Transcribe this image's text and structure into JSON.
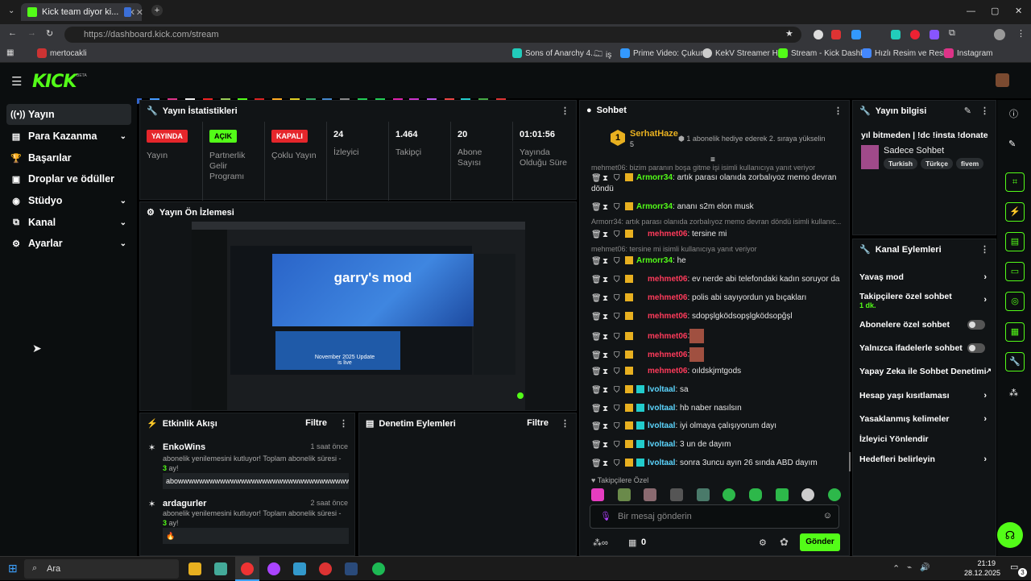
{
  "browser": {
    "tab_title": "Kick team diyor ki...",
    "url": "https://dashboard.kick.com/stream",
    "bookmarks": [
      "mertocakli",
      "Sons of Anarchy 4....",
      "iş",
      "Prime Video: Çukur...",
      "KekV Streamer Hub",
      "Stream - Kick Dashb...",
      "Hızlı Resim ve Resi...",
      "Instagram"
    ]
  },
  "logo": "KICK",
  "logo_beta": "BETA",
  "sidebar": [
    {
      "label": "Yayın",
      "icon": "broadcast-icon"
    },
    {
      "label": "Para Kazanma",
      "icon": "money-icon"
    },
    {
      "label": "Başarılar",
      "icon": "trophy-icon"
    },
    {
      "label": "Droplar ve ödüller",
      "icon": "gift-icon"
    },
    {
      "label": "Stüdyo",
      "icon": "studio-icon"
    },
    {
      "label": "Kanal",
      "icon": "channel-icon"
    },
    {
      "label": "Ayarlar",
      "icon": "settings-icon"
    }
  ],
  "stats": {
    "title": "Yayın İstatistikleri",
    "items": [
      {
        "badge": "YAYINDA",
        "badge_color": "#e5262b",
        "label": "Yayın"
      },
      {
        "badge": "AÇIK",
        "badge_color": "#53fc18",
        "label": "Partnerlik Gelir Programı"
      },
      {
        "badge": "KAPALI",
        "badge_color": "#e5262b",
        "label": "Çoklu Yayın"
      },
      {
        "num": "24",
        "label": "İzleyici"
      },
      {
        "num": "1.464",
        "label": "Takipçi"
      },
      {
        "num": "20",
        "label": "Abone Sayısı"
      },
      {
        "num": "01:01:56",
        "label": "Yayında Olduğu Süre"
      }
    ]
  },
  "preview": {
    "title": "Yayın Ön İzlemesi",
    "game": "garry's mod",
    "news": "November 2025 Update is live"
  },
  "activity": {
    "title": "Etkinlik Akışı",
    "filter": "Filtre",
    "items": [
      {
        "user": "EnkoWins",
        "time": "1 saat önce",
        "text_a": "abonelik yenilemesini kutluyor! Toplam abonelik süresi - ",
        "text_num": "3",
        "text_b": " ay!",
        "msg": "abowwwwwwwwwwwwwwwwwwwwwwwwwwwwwwwwwwwwwwwwwwwwwwwww"
      },
      {
        "user": "ardagurler",
        "time": "2 saat önce",
        "text_a": "abonelik yenilemesini kutluyor! Toplam abonelik süresi - ",
        "text_num": "3",
        "text_b": " ay!",
        "msg": "🔥"
      }
    ]
  },
  "moderation": {
    "title": "Denetim Eylemleri",
    "filter": "Filtre"
  },
  "chat": {
    "title": "Sohbet",
    "pinned_user": "SerhatHaze",
    "pinned_count": "5",
    "pinned_rank": "1",
    "pinned_text": "1 abonelik hediye ederek 2. sıraya yükselin",
    "top_reply": "mehmet06: bizim paranın boşa gitme işi isimli kullanıcıya yanıt veriyor",
    "messages": [
      {
        "user": "Armorr34",
        "text": ": artık parası olanıda zorbalıyoz memo devran döndü",
        "color": "green"
      },
      {
        "user": "Armorr34",
        "text": ": ananı s2m elon musk",
        "color": "green"
      },
      {
        "reply": "Armorr34: artık parası olanıda zorbalıyoz memo devran döndü isimli kullanıc..."
      },
      {
        "user": "mehmet06",
        "text": ": tersine mi",
        "color": "red"
      },
      {
        "reply": "mehmet06: tersine mi isimli kullanıcıya yanıt veriyor"
      },
      {
        "user": "Armorr34",
        "text": ": he",
        "color": "green"
      },
      {
        "user": "mehmet06",
        "text": ": ev nerde abi telefondaki kadın soruyor da",
        "color": "red"
      },
      {
        "user": "mehmet06",
        "text": ": polis abi sayıyordun ya bıçakları",
        "color": "red"
      },
      {
        "user": "mehmet06",
        "text": ": sdopşlgködsopşlgködsopğşl",
        "color": "red"
      },
      {
        "user": "mehmet06",
        "text": ":",
        "color": "red"
      },
      {
        "user": "mehmet06",
        "text": ":",
        "color": "red"
      },
      {
        "user": "mehmet06",
        "text": ": oıldskjmtgods",
        "color": "red"
      },
      {
        "user": "lvoltaal",
        "text": ": sa",
        "color": "teal"
      },
      {
        "user": "lvoltaal",
        "text": ": hb naber nasılsın",
        "color": "teal"
      },
      {
        "user": "lvoltaal",
        "text": ": iyi olmaya çalışıyorum dayı",
        "color": "teal"
      },
      {
        "user": "lvoltaal",
        "text": ": 3 un de dayım",
        "color": "teal"
      },
      {
        "user": "lvoltaal",
        "text": ": sonra 3uncu ayın 26 sında ABD dayım",
        "color": "teal"
      }
    ],
    "emote_label": "Takipçilere Özel",
    "placeholder": "Bir mesaj gönderin",
    "points": "0",
    "send": "Gönder"
  },
  "info": {
    "title": "Yayın bilgisi",
    "stream_title": "yıl bitmeden | !dc !insta !donate",
    "category": "Sadece Sohbet",
    "tags": [
      "Turkish",
      "Türkçe",
      "fivem"
    ]
  },
  "channel_actions": {
    "title": "Kanal Eylemleri",
    "items": [
      {
        "label": "Yavaş mod",
        "kind": "chev"
      },
      {
        "label": "Takipçilere özel sohbet",
        "sub": "1 dk.",
        "kind": "chev"
      },
      {
        "label": "Abonelere özel sohbet",
        "kind": "toggle"
      },
      {
        "label": "Yalnızca ifadelerle sohbet",
        "kind": "toggle"
      },
      {
        "label": "Yapay Zeka ile Sohbet Denetimi",
        "kind": "ext"
      },
      {
        "label": "Hesap yaşı kısıtlaması",
        "kind": "chev"
      },
      {
        "label": "Yasaklanmış kelimeler",
        "kind": "chev"
      },
      {
        "label": "İzleyici Yönlendir",
        "kind": "none"
      },
      {
        "label": "Hedefleri belirleyin",
        "kind": "chev"
      }
    ]
  },
  "taskbar": {
    "search": "Ara",
    "time": "21:19",
    "date": "28.12.2025",
    "notif": "3"
  }
}
